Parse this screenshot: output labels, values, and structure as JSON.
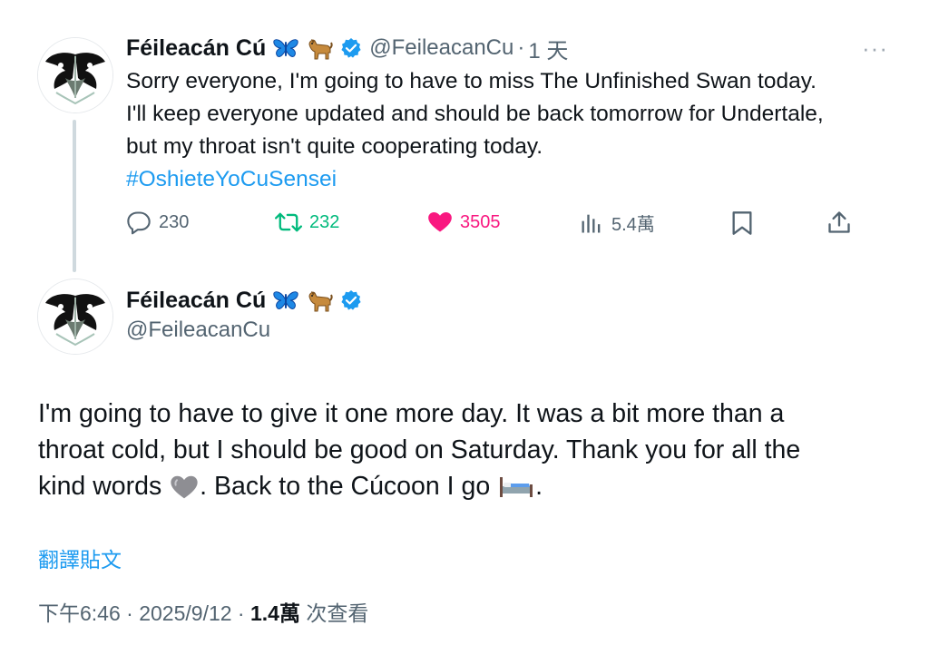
{
  "colors": {
    "link": "#1d9bf0",
    "retweet": "#00ba7c",
    "like": "#f91880",
    "muted": "#536471",
    "text": "#0f1419",
    "verified": "#1d9bf0"
  },
  "tweet1": {
    "avatar_icon": "moth-avatar",
    "display_name": "Féileacán Cú",
    "emojis": [
      "butterfly-emoji",
      "dog-emoji"
    ],
    "handle": "@FeileacanCu",
    "separator": "·",
    "time": "1 天",
    "more": "···",
    "text_lines": [
      "Sorry everyone, I'm going to have to miss The Unfinished Swan today.",
      "I'll keep everyone updated and should be back tomorrow for Undertale,",
      "but my throat isn't quite cooperating today."
    ],
    "hashtag": "#OshieteYoCuSensei",
    "actions": {
      "replies": "230",
      "retweets": "232",
      "likes": "3505",
      "views": "5.4萬"
    }
  },
  "tweet2": {
    "avatar_icon": "moth-avatar",
    "display_name": "Féileacán Cú",
    "emojis": [
      "butterfly-emoji",
      "dog-emoji"
    ],
    "handle": "@FeileacanCu",
    "text_lines": [
      "I'm going to have to give it one more day. It was a bit more than a",
      "throat cold, but I should be good on Saturday. Thank you for all the"
    ],
    "line3_part1": "kind words ",
    "line3_part2": ". Back to the Cúcoon I go ",
    "line3_part3": ".",
    "inline_emojis": [
      "grey-heart-emoji",
      "bed-emoji"
    ],
    "translate": "翻譯貼文",
    "meta": {
      "time": "下午6:46",
      "sep1": " · ",
      "date": "2025/9/12",
      "sep2": " · ",
      "views": "1.4萬",
      "views_label": " 次查看"
    }
  }
}
